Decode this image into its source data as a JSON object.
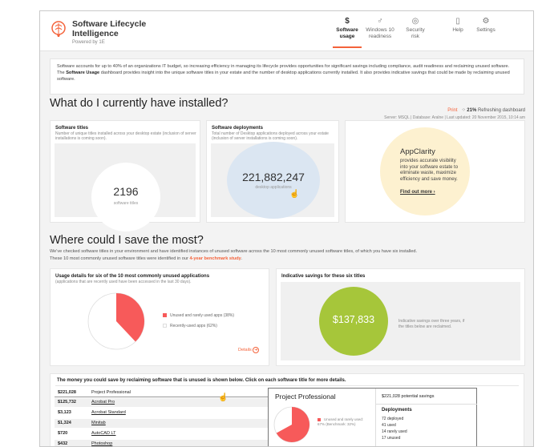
{
  "header": {
    "title_line1": "Software Lifecycle",
    "title_line2": "Intelligence",
    "powered_by": "Powered by 1E",
    "nav": [
      {
        "l1": "Software",
        "l2": "usage",
        "icon": "$"
      },
      {
        "l1": "Windows 10",
        "l2": "readiness",
        "icon": "♂"
      },
      {
        "l1": "Security",
        "l2": "risk",
        "icon": "◎"
      },
      {
        "l1": "Help",
        "l2": "",
        "icon": "▯"
      },
      {
        "l1": "Settings",
        "l2": "",
        "icon": "⚙"
      }
    ]
  },
  "intro": {
    "p1": "Software accounts for up to 40% of an organizations IT budget, so increasing efficiency in managing its lifecycle provides opportunities for significant savings including compliance, audit readiness and reclaiming unused software. The ",
    "bold": "Software Usage",
    "p2": " dashboard provides insight into the unique software titles in your estate and the number of desktop applications currently installed. It also provides indicative savings that could be made by reclaiming unused software."
  },
  "section1": {
    "title": "What do I currently have installed?",
    "print": "Print",
    "refresh_pct": "21%",
    "refresh_text": "Refreshing dashboard",
    "server_info": "Server: MSQL | Database: Aralne | Last updated: 20 November 2015, 10:14 am"
  },
  "card_titles": {
    "title": "Software titles",
    "sub": "Number of unique titles installed across your desktop estate (inclusion of server installations is coming soon).",
    "value": "2196",
    "label": "software titles"
  },
  "card_deploy": {
    "title": "Software deployments",
    "sub": "Total number of Desktop applications deployed across your estate (inclusion of server installations is coming soon).",
    "value": "221,882,247",
    "label": "desktop applications"
  },
  "appclarity": {
    "title": "AppClarity",
    "text": "provides accurate visibility into your software estate to eliminate waste, maximize efficiency and save money.",
    "link": "Find out more ›"
  },
  "section2": {
    "title": "Where could I save the most?",
    "desc_a": "We've checked software titles in your environment and have identified instances of unused software across the 10 most commonly unused software titles, of which you have six installed.",
    "desc_b": "These 10 most commonly unused software titles were identified in our ",
    "desc_link": "4-year benchmark study",
    "desc_end": "."
  },
  "usage_card": {
    "title": "Usage details for six of the 10 most commonly unused applications",
    "sub": "(applications that are recently used have been accessed in the last 30 days).",
    "legend_unused": "Unused and rarely used apps (38%)",
    "legend_recent": "Recently-used apps (62%)",
    "details": "Details",
    "unused_pct": 38,
    "color_unused": "#f75a5a",
    "color_recent": "#ffffff"
  },
  "savings_card": {
    "title": "Indicative savings for these six titles",
    "value": "$137,833",
    "note": "Indicative savings over three years, if the titles below are reclaimed.",
    "color": "#a6c63a"
  },
  "table": {
    "title": "The money you could save by reclaiming software that is unused is shown below. Click on each software title for more details.",
    "rows": [
      {
        "amount": "$221,028",
        "name": "Project Professional"
      },
      {
        "amount": "$125,732",
        "name": "Acrobat Pro"
      },
      {
        "amount": "$3,123",
        "name": "Acrobat Standard"
      },
      {
        "amount": "$1,324",
        "name": "Minitab"
      },
      {
        "amount": "$720",
        "name": "AutoCAD LT"
      },
      {
        "amount": "$432",
        "name": "Photoshop"
      }
    ]
  },
  "detail": {
    "title": "Project Professional",
    "savings": "$221,028 potential savings",
    "deployments": "Deployments",
    "stats": [
      "72 deployed",
      "41 used",
      "14 rarely used",
      "17 unused"
    ],
    "note": "Unused and rarely used: 67% (Benchmark: 32%)",
    "unused_pct": 67
  }
}
